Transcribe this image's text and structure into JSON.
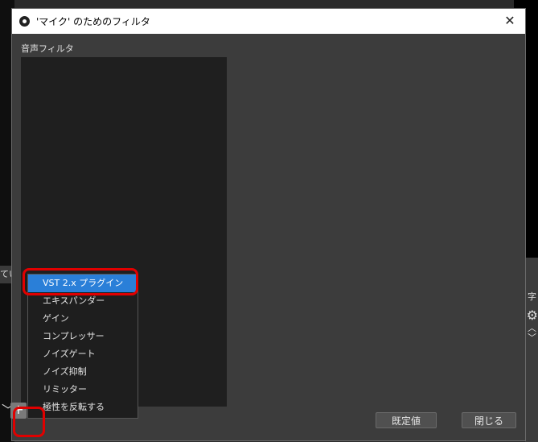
{
  "background": {
    "left_fragment_text": "てい",
    "right_fragment_text": "字"
  },
  "dialog": {
    "title": "'マイク' のためのフィルタ",
    "close_glyph": "✕",
    "section_label": "音声フィルタ",
    "buttons": {
      "defaults": "既定値",
      "close": "閉じる"
    },
    "list_controls": {
      "add": "+",
      "remove": "−",
      "up": "︿",
      "down": "﹀"
    }
  },
  "dropdown_menu": {
    "items": [
      "VST 2.x プラグイン",
      "エキスパンダー",
      "ゲイン",
      "コンプレッサー",
      "ノイズゲート",
      "ノイズ抑制",
      "リミッター",
      "極性を反転する"
    ],
    "selected_index": 0
  },
  "colors": {
    "selection": "#2a7fd8",
    "highlight_outline": "#e00000",
    "dialog_bg": "#3c3c3c",
    "list_bg": "#1f1f1f"
  },
  "icons": {
    "app": "obs-logo-icon",
    "gear": "gear-icon",
    "chevron_left": "chevron-down-icon"
  }
}
